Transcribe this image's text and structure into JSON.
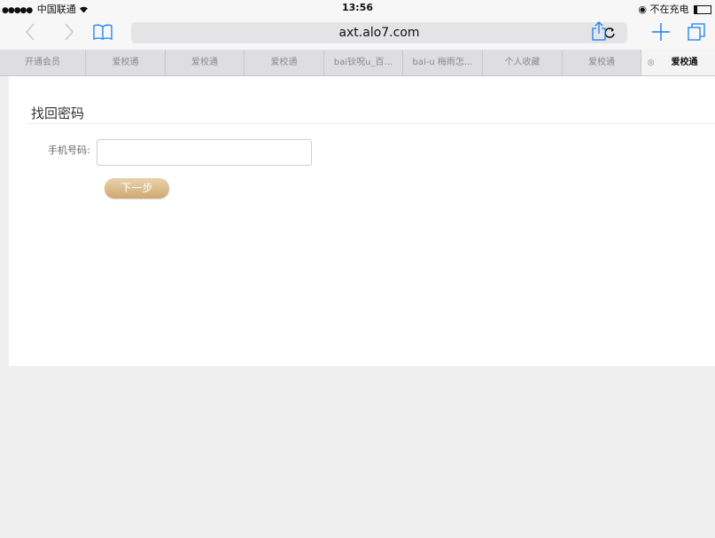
{
  "status_bar": {
    "signal_dots": "●●●●●",
    "carrier": "中国联通",
    "wifi": "wifi",
    "time": "13:56",
    "battery_status": "不在充电"
  },
  "nav": {
    "back_icon": "chevron-left",
    "forward_icon": "chevron-right",
    "bookmarks_icon": "book",
    "address": "axt.alo7.com",
    "reload_icon": "reload",
    "share_icon": "share",
    "new_tab_icon": "plus",
    "tabs_icon": "tabs"
  },
  "tabs": [
    {
      "label": "开通会员"
    },
    {
      "label": "爱校通"
    },
    {
      "label": "爱校通"
    },
    {
      "label": "爱校通"
    },
    {
      "label": "bai钬呪u_百..."
    },
    {
      "label": "bai-u 梅雨怎..."
    },
    {
      "label": "个人收藏"
    },
    {
      "label": "爱校通"
    },
    {
      "label": "爱校通",
      "active": true
    }
  ],
  "page": {
    "title": "找回密码",
    "phone_label": "手机号码:",
    "phone_value": "",
    "next_button": "下一步"
  },
  "colors": {
    "ios_blue": "#1a7cf5",
    "button_gold": "#d9b88a"
  }
}
